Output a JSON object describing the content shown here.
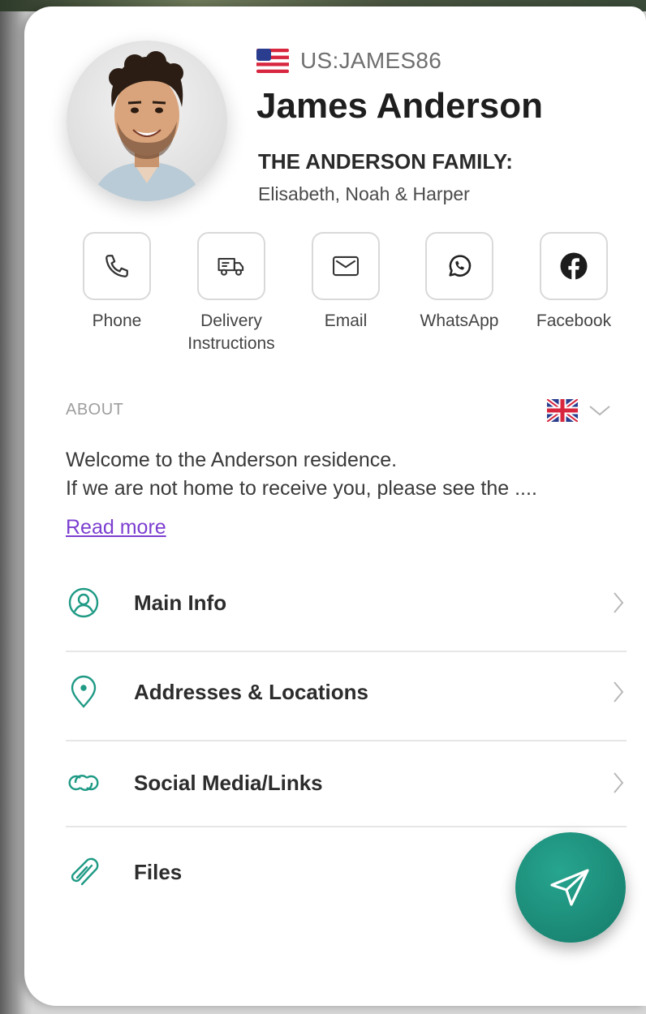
{
  "profile": {
    "handle": "US:JAMES86",
    "name": "James Anderson",
    "family_title": "THE ANDERSON FAMILY:",
    "family_members": "Elisabeth, Noah & Harper"
  },
  "actions": [
    {
      "label": "Phone",
      "icon": "phone-icon"
    },
    {
      "label": "Delivery Instructions",
      "icon": "truck-icon"
    },
    {
      "label": "Email",
      "icon": "mail-icon"
    },
    {
      "label": "WhatsApp",
      "icon": "whatsapp-icon"
    },
    {
      "label": "Facebook",
      "icon": "facebook-icon"
    }
  ],
  "about": {
    "label": "ABOUT",
    "line1": "Welcome to the Anderson residence.",
    "line2": "If we are not home to receive you, please see the ....",
    "read_more": "Read more"
  },
  "menu": [
    {
      "label": "Main Info",
      "icon": "user-circle-icon"
    },
    {
      "label": "Addresses & Locations",
      "icon": "location-pin-icon"
    },
    {
      "label": "Social Media/Links",
      "icon": "link-icon"
    },
    {
      "label": "Files",
      "icon": "paperclip-icon"
    }
  ],
  "colors": {
    "accent": "#1f9a85",
    "link": "#7c3fd0",
    "fab": "#1a8c78"
  }
}
